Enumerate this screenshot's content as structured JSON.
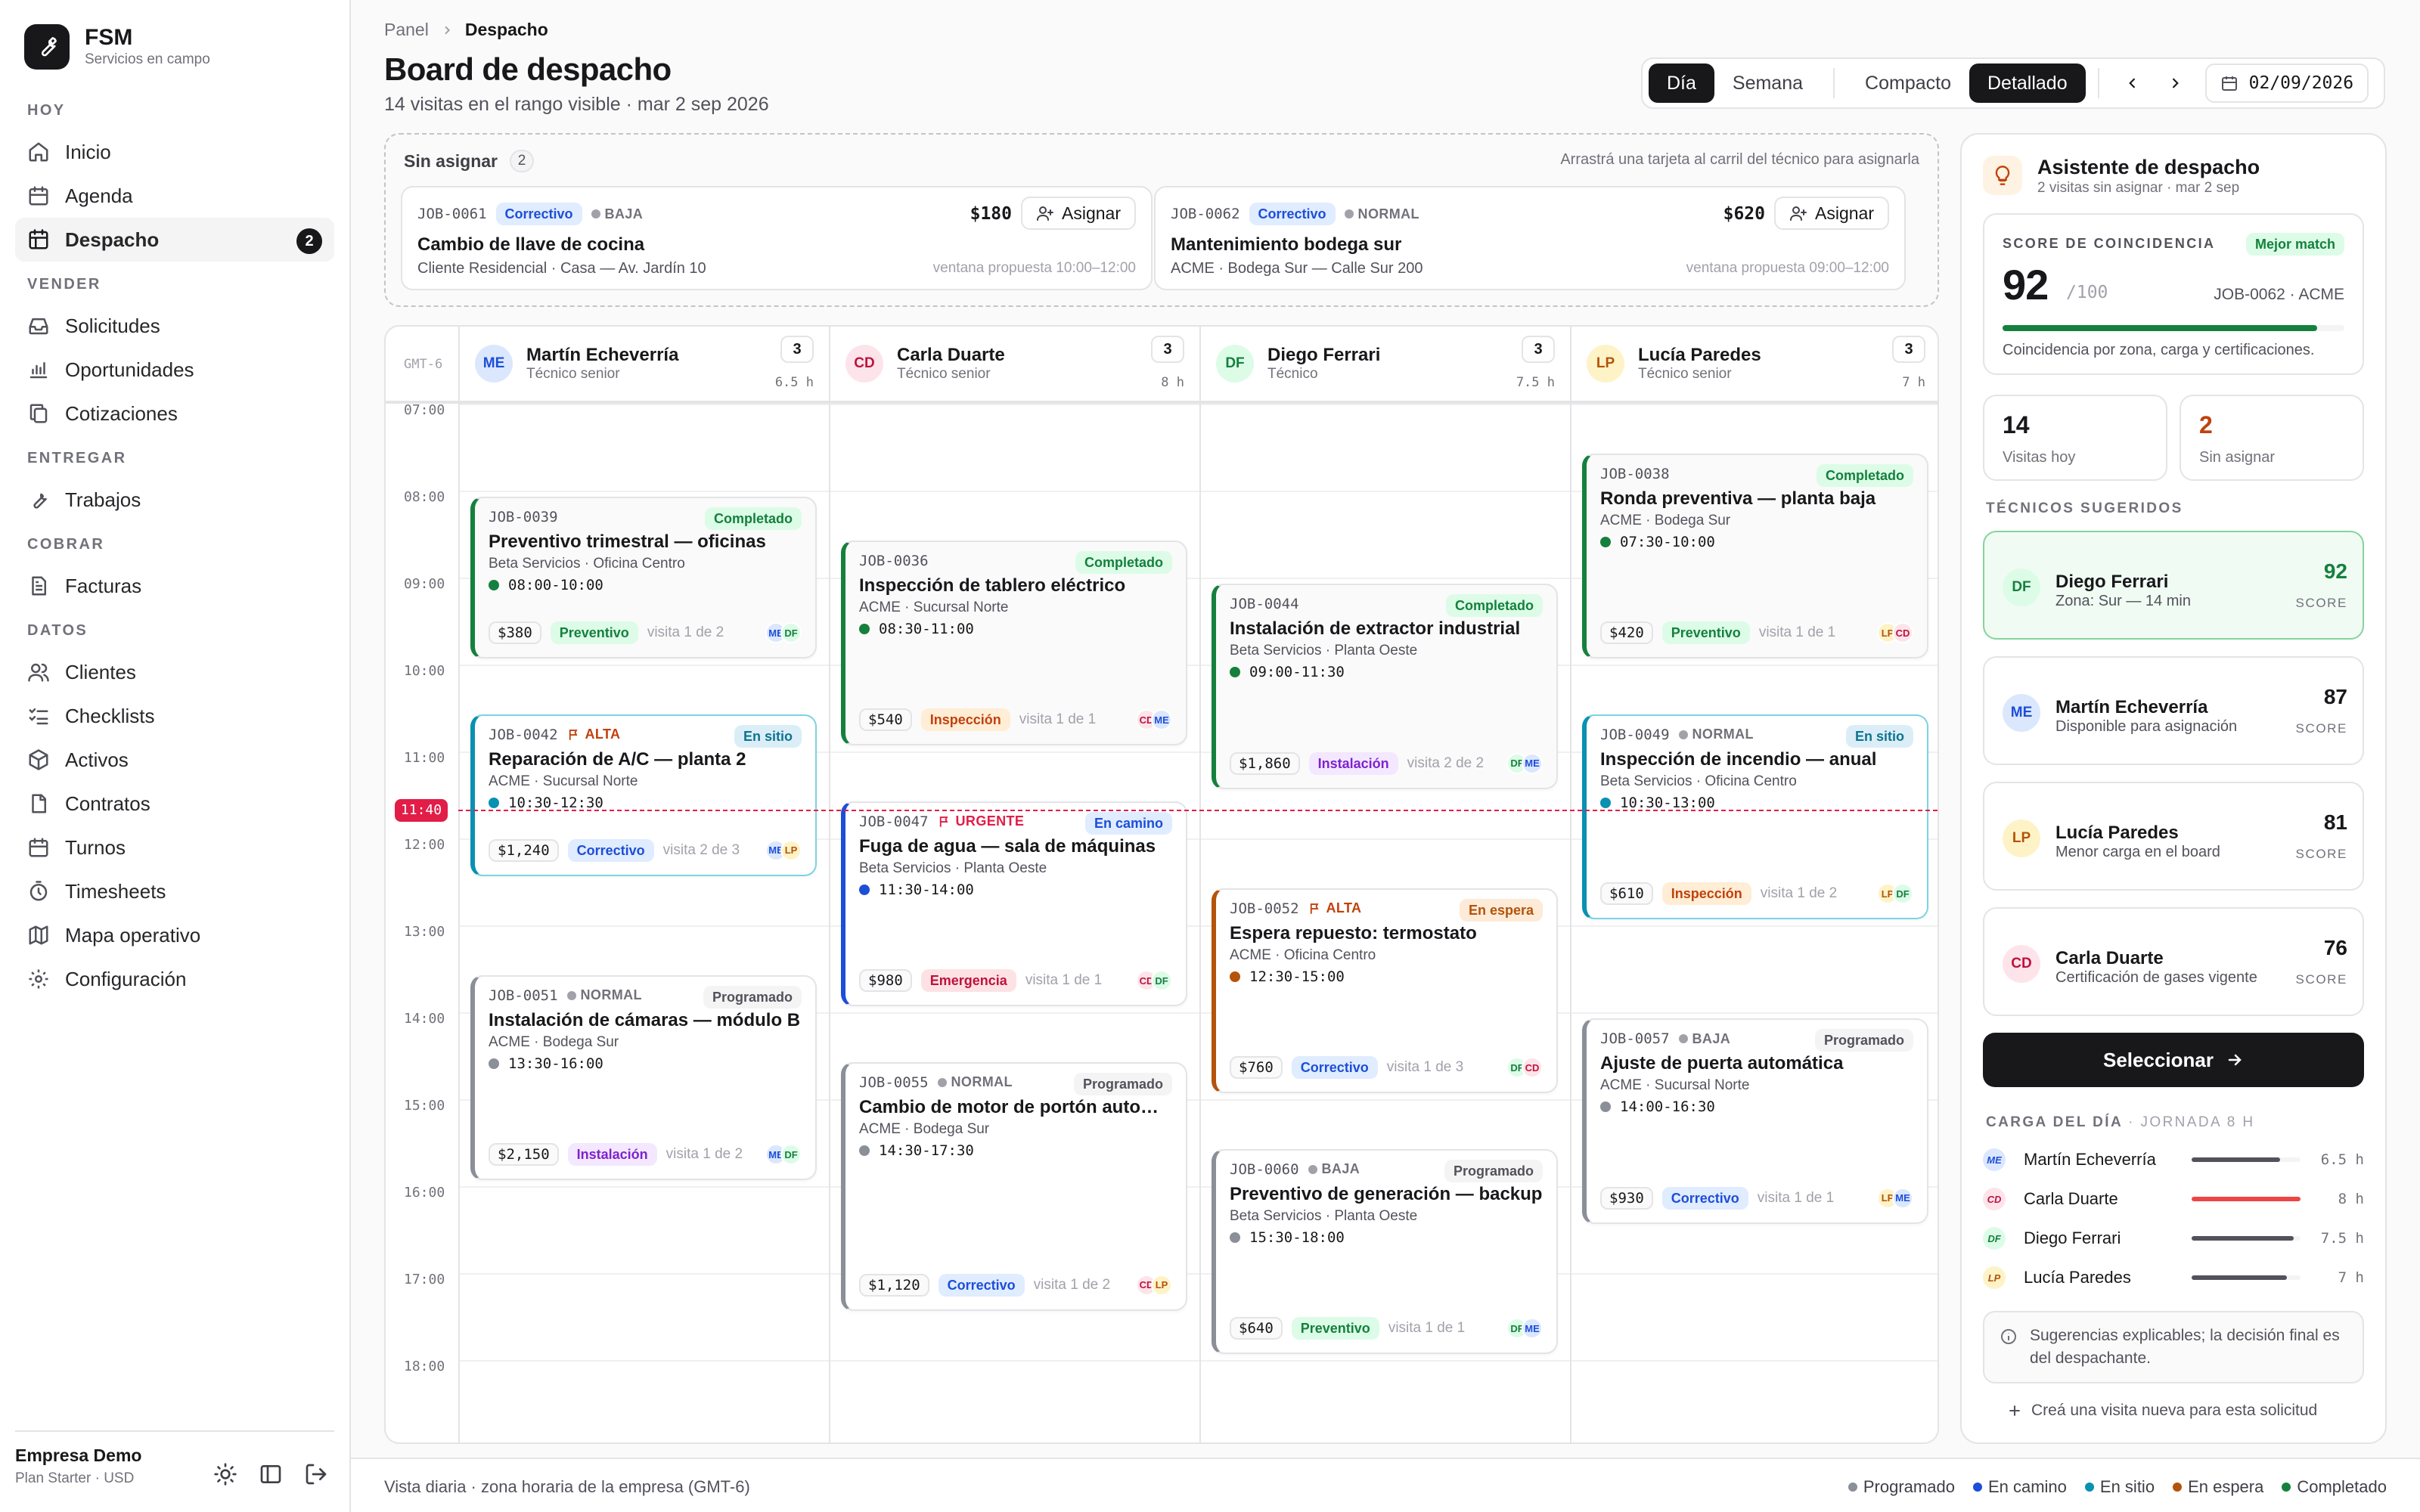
{
  "brand": {
    "title": "FSM",
    "subtitle": "Servicios en campo"
  },
  "nav": {
    "g1": "HOY",
    "inicio": "Inicio",
    "agenda": "Agenda",
    "despacho": "Despacho",
    "despacho_badge": "2",
    "g2": "VENDER",
    "solicitudes": "Solicitudes",
    "oportunidades": "Oportunidades",
    "cotizaciones": "Cotizaciones",
    "g3": "ENTREGAR",
    "trabajos": "Trabajos",
    "g4": "COBRAR",
    "facturas": "Facturas",
    "g5": "DATOS",
    "clientes": "Clientes",
    "checklists": "Checklists",
    "activos": "Activos",
    "contratos": "Contratos",
    "turnos": "Turnos",
    "timesheets": "Timesheets",
    "mapa": "Mapa operativo",
    "config": "Configuración"
  },
  "org": {
    "name": "Empresa Demo",
    "plan": "Plan Starter · USD"
  },
  "header": {
    "crumb_root": "Panel",
    "crumb_current": "Despacho",
    "title": "Board de despacho",
    "subtitle": "14 visitas en el rango visible · mar 2 sep 2026"
  },
  "toolbar": {
    "dia": "Día",
    "semana": "Semana",
    "compacto": "Compacto",
    "detallado": "Detallado",
    "date": "02/09/2026"
  },
  "unassigned": {
    "label": "Sin asignar",
    "count": "2",
    "hint": "Arrastrá una tarjeta al carril del técnico para asignarla",
    "cards": [
      {
        "id": "JOB-0061",
        "type": "Correctivo",
        "prio": "BAJA",
        "price": "$180",
        "btn": "Asignar",
        "title": "Cambio de llave de cocina",
        "sub": "Cliente Residencial · Casa — Av. Jardín 10",
        "window": "ventana propuesta 10:00–12:00"
      },
      {
        "id": "JOB-0062",
        "type": "Correctivo",
        "prio": "NORMAL",
        "price": "$620",
        "btn": "Asignar",
        "title": "Mantenimiento bodega sur",
        "sub": "ACME · Bodega Sur — Calle Sur 200",
        "window": "ventana propuesta 09:00–12:00"
      }
    ]
  },
  "board": {
    "tz": "GMT-6",
    "now": "11:40",
    "hours": [
      "07:00",
      "08:00",
      "09:00",
      "10:00",
      "11:00",
      "12:00",
      "13:00",
      "14:00",
      "15:00",
      "16:00",
      "17:00",
      "18:00"
    ],
    "techs": [
      {
        "initials": "ME",
        "name": "Martín Echeverría",
        "role": "Técnico senior",
        "count": "3",
        "hours": "6.5 h"
      },
      {
        "initials": "CD",
        "name": "Carla Duarte",
        "role": "Técnico senior",
        "count": "3",
        "hours": "8 h"
      },
      {
        "initials": "DF",
        "name": "Diego Ferrari",
        "role": "Técnico",
        "count": "3",
        "hours": "7.5 h"
      },
      {
        "initials": "LP",
        "name": "Lucía Paredes",
        "role": "Técnico senior",
        "count": "3",
        "hours": "7 h"
      }
    ],
    "jobs": [
      {
        "id": "JOB-0039",
        "prio": "",
        "status": "Completado",
        "title": "Preventivo trimestral — oficinas",
        "sub": "Beta Servicios · Oficina Centro",
        "time": "08:00-10:00",
        "price": "$380",
        "type": "Preventivo",
        "visit": "visita 1 de 2",
        "a1": "ME",
        "a2": "DF"
      },
      {
        "id": "JOB-0042",
        "prio": "ALTA",
        "status": "En sitio",
        "title": "Reparación de A/C — planta 2",
        "sub": "ACME · Sucursal Norte",
        "time": "10:30-12:30",
        "price": "$1,240",
        "type": "Correctivo",
        "visit": "visita 2 de 3",
        "a1": "ME",
        "a2": "LP"
      },
      {
        "id": "JOB-0051",
        "prio": "NORMAL",
        "status": "Programado",
        "title": "Instalación de cámaras — módulo B",
        "sub": "ACME · Bodega Sur",
        "time": "13:30-16:00",
        "price": "$2,150",
        "type": "Instalación",
        "visit": "visita 1 de 2",
        "a1": "ME",
        "a2": "DF"
      },
      {
        "id": "JOB-0036",
        "prio": "",
        "status": "Completado",
        "title": "Inspección de tablero eléctrico",
        "sub": "ACME · Sucursal Norte",
        "time": "08:30-11:00",
        "price": "$540",
        "type": "Inspección",
        "visit": "visita 1 de 1",
        "a1": "CD",
        "a2": "ME"
      },
      {
        "id": "JOB-0047",
        "prio": "URGENTE",
        "status": "En camino",
        "title": "Fuga de agua — sala de máquinas",
        "sub": "Beta Servicios · Planta Oeste",
        "time": "11:30-14:00",
        "price": "$980",
        "type": "Emergencia",
        "visit": "visita 1 de 1",
        "a1": "CD",
        "a2": "DF"
      },
      {
        "id": "JOB-0055",
        "prio": "NORMAL",
        "status": "Programado",
        "title": "Cambio de motor de portón automático",
        "sub": "ACME · Bodega Sur",
        "time": "14:30-17:30",
        "price": "$1,120",
        "type": "Correctivo",
        "visit": "visita 1 de 2",
        "a1": "CD",
        "a2": "LP"
      },
      {
        "id": "JOB-0044",
        "prio": "",
        "status": "Completado",
        "title": "Instalación de extractor industrial",
        "sub": "Beta Servicios · Planta Oeste",
        "time": "09:00-11:30",
        "price": "$1,860",
        "type": "Instalación",
        "visit": "visita 2 de 2",
        "a1": "DF",
        "a2": "ME"
      },
      {
        "id": "JOB-0052",
        "prio": "ALTA",
        "status": "En espera",
        "title": "Espera repuesto: termostato",
        "sub": "ACME · Oficina Centro",
        "time": "12:30-15:00",
        "price": "$760",
        "type": "Correctivo",
        "visit": "visita 1 de 3",
        "a1": "DF",
        "a2": "CD"
      },
      {
        "id": "JOB-0060",
        "prio": "BAJA",
        "status": "Programado",
        "title": "Preventivo de generación — backup",
        "sub": "Beta Servicios · Planta Oeste",
        "time": "15:30-18:00",
        "price": "$640",
        "type": "Preventivo",
        "visit": "visita 1 de 1",
        "a1": "DF",
        "a2": "ME"
      },
      {
        "id": "JOB-0038",
        "prio": "",
        "status": "Completado",
        "title": "Ronda preventiva — planta baja",
        "sub": "ACME · Bodega Sur",
        "time": "07:30-10:00",
        "price": "$420",
        "type": "Preventivo",
        "visit": "visita 1 de 1",
        "a1": "LP",
        "a2": "CD"
      },
      {
        "id": "JOB-0049",
        "prio": "NORMAL",
        "status": "En sitio",
        "title": "Inspección de incendio — anual",
        "sub": "Beta Servicios · Oficina Centro",
        "time": "10:30-13:00",
        "price": "$610",
        "type": "Inspección",
        "visit": "visita 1 de 2",
        "a1": "LP",
        "a2": "DF"
      },
      {
        "id": "JOB-0057",
        "prio": "BAJA",
        "status": "Programado",
        "title": "Ajuste de puerta automática",
        "sub": "ACME · Sucursal Norte",
        "time": "14:00-16:30",
        "price": "$930",
        "type": "Correctivo",
        "visit": "visita 1 de 1",
        "a1": "LP",
        "a2": "ME"
      }
    ]
  },
  "assistant": {
    "title": "Asistente de despacho",
    "subtitle": "2 visitas sin asignar · mar 2 sep",
    "score_label": "SCORE DE COINCIDENCIA",
    "best": "Mejor match",
    "score": "92",
    "score_of": "/100",
    "score_job": "JOB-0062 · ACME",
    "score_fraction": 0.92,
    "score_note": "Coincidencia por zona, carga y certificaciones.",
    "stat1_value": "14",
    "stat1_label": "Visitas hoy",
    "stat2_value": "2",
    "stat2_label": "Sin asignar",
    "suggested_label": "TÉCNICOS SUGERIDOS",
    "score_word": "SCORE",
    "suggestions": [
      {
        "initials": "DF",
        "name": "Diego Ferrari",
        "note": "Zona: Sur — 14 min",
        "score": "92"
      },
      {
        "initials": "ME",
        "name": "Martín Echeverría",
        "note": "Disponible para asignación",
        "score": "87"
      },
      {
        "initials": "LP",
        "name": "Lucía Paredes",
        "note": "Menor carga en el board",
        "score": "81"
      },
      {
        "initials": "CD",
        "name": "Carla Duarte",
        "note": "Certificación de gases vigente",
        "score": "76"
      }
    ],
    "select": "Seleccionar",
    "load_label": "CARGA DEL DÍA",
    "load_sub": "· JORNADA 8 H",
    "load": [
      {
        "initials": "ME",
        "name": "Martín Echeverría",
        "hours": "6.5 h",
        "fraction": 0.8125
      },
      {
        "initials": "CD",
        "name": "Carla Duarte",
        "hours": "8 h",
        "fraction": 1.0
      },
      {
        "initials": "DF",
        "name": "Diego Ferrari",
        "hours": "7.5 h",
        "fraction": 0.9375
      },
      {
        "initials": "LP",
        "name": "Lucía Paredes",
        "hours": "7 h",
        "fraction": 0.875
      }
    ],
    "note": "Sugerencias explicables; la decisión final es del despachante.",
    "new_visit": "Creá una visita nueva para esta solicitud"
  },
  "footer": {
    "left": "Vista diaria · zona horaria de la empresa (GMT-6)",
    "legend": [
      "Programado",
      "En camino",
      "En sitio",
      "En espera",
      "Completado"
    ]
  },
  "colors": {
    "programado": "#8a8f98",
    "en_camino": "#1d4ed8",
    "en_sitio": "#0891b2",
    "en_espera": "#b45309",
    "completado": "#15803d",
    "urgent": "#e11d48"
  }
}
